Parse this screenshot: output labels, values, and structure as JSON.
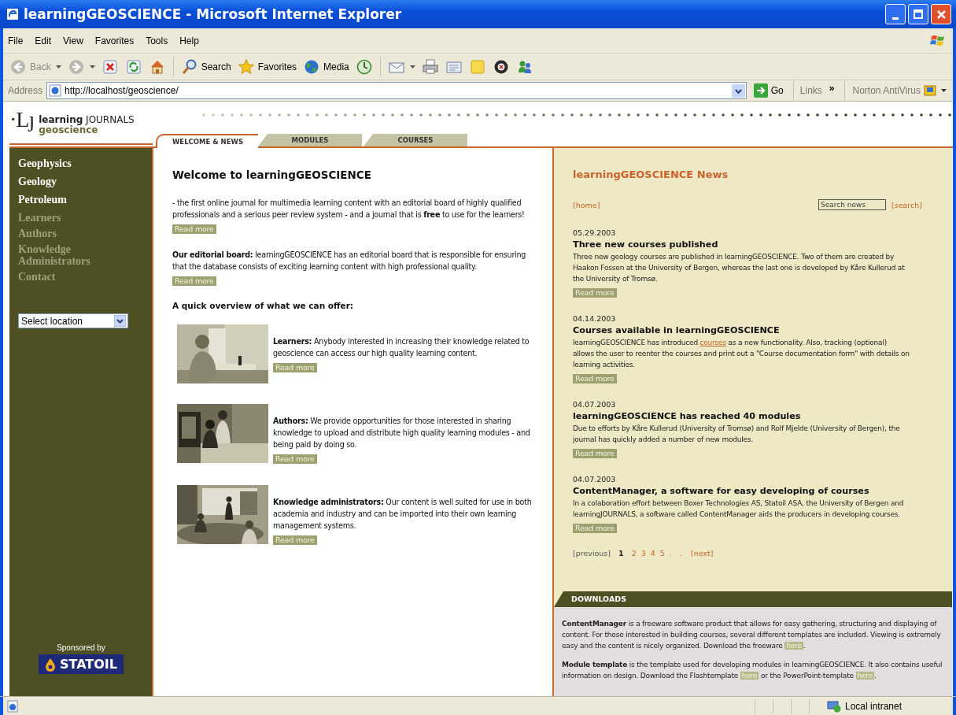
{
  "window": {
    "title": "learningGEOSCIENCE - Microsoft Internet Explorer"
  },
  "menu_bar": [
    "File",
    "Edit",
    "View",
    "Favorites",
    "Tools",
    "Help"
  ],
  "toolbar": [
    {
      "kind": "back",
      "label": "Back",
      "dropdown": true
    },
    {
      "kind": "forward",
      "dropdown": true
    },
    {
      "kind": "stop",
      "dropdown": false
    },
    {
      "kind": "refresh",
      "dropdown": false
    },
    {
      "kind": "home",
      "dropdown": false
    },
    {
      "kind": "separator"
    },
    {
      "kind": "search",
      "label": "Search",
      "dropdown": false
    },
    {
      "kind": "favorites",
      "label": "Favorites",
      "dropdown": false
    },
    {
      "kind": "media",
      "label": "Media",
      "dropdown": false
    },
    {
      "kind": "history",
      "dropdown": false
    },
    {
      "kind": "separator"
    },
    {
      "kind": "mail",
      "dropdown": true
    },
    {
      "kind": "print",
      "dropdown": false
    },
    {
      "kind": "edit",
      "dropdown": false
    },
    {
      "kind": "note",
      "dropdown": false
    },
    {
      "kind": "disc",
      "dropdown": false
    },
    {
      "kind": "people",
      "dropdown": false
    }
  ],
  "address_bar": {
    "label": "Address",
    "url": "http://localhost/geoscience/",
    "go": "Go",
    "links": "Links",
    "links_more": "»",
    "norton": "Norton AntiVirus"
  },
  "site_header": {
    "logo_mark": "·Lȷ",
    "logo_title": "**learning** JOURNALS",
    "logo_subtitle": "geoscience"
  },
  "tabs": [
    {
      "label": "WELCOME & NEWS",
      "selected": true
    },
    {
      "label": "MODULES",
      "selected": false
    },
    {
      "label": "COURSES",
      "selected": false
    }
  ],
  "sidebar": {
    "items": [
      {
        "label": "Geophysics",
        "kind": "primary"
      },
      {
        "label": "Geology",
        "kind": "primary"
      },
      {
        "label": "Petroleum",
        "kind": "primary"
      },
      {
        "label": "Learners",
        "kind": "secondary"
      },
      {
        "label": "Authors",
        "kind": "secondary"
      },
      {
        "label": "Knowledge Administrators",
        "kind": "secondary"
      },
      {
        "label": "Contact",
        "kind": "secondary"
      }
    ],
    "location_select": {
      "value": "Select location"
    },
    "sponsor": {
      "caption": "Sponsored by",
      "name": "STATOIL"
    }
  },
  "welcome": {
    "title": "Welcome to learningGEOSCIENCE",
    "intro": [
      {
        "text": "- the first online journal for multimedia learning content with an editorial board of highly qualified professionals and a serious peer review system - and a journal that is **free** to use for the learners!",
        "link": "Read more"
      },
      {
        "text": "**Our editorial board:** learningGEOSCIENCE has an editorial board that is responsible for ensuring that the database consists of exciting learning content with high professional quality.",
        "link": "Read more"
      }
    ],
    "overview_title": "A quick overview of what we can offer:",
    "offers": [
      {
        "text": "**Learners:** Anybody interested in increasing their knowledge related to geoscience can access our high quality learning content.",
        "link": "Read more"
      },
      {
        "text": "**Authors:** We provide opportunities for those interested in sharing knowledge to upload and distribute high quality learning modules - and being paid by doing so.",
        "link": "Read more"
      },
      {
        "text": "**Knowledge administrators:** Our content is well suited for use in both academia and industry and can be imported into their own learning management systems.",
        "link": "Read more"
      }
    ]
  },
  "news": {
    "title": "learningGEOSCIENCE News",
    "home_link": "[home]",
    "search": {
      "placeholder": "Search news"
    },
    "search_link": "[search]",
    "items": [
      {
        "date": "05.29.2003",
        "title": "Three new courses published",
        "text": [
          {
            "text": "Three new geology courses are published in learningGEOSCIENCE. Two of them are created by Haakon Fossen at the University of Bergen, whereas the last one is developed by Kåre Kullerud at the University of Tromsø."
          }
        ],
        "link": "Read more"
      },
      {
        "date": "04.14.2003",
        "title": "Courses available in learningGEOSCIENCE",
        "text": [
          {
            "text": "learningGEOSCIENCE has introduced "
          },
          {
            "link": "courses"
          },
          {
            "text": " as a new functionality. Also, tracking (optional) allows the user to reenter the courses and print out a \"Course documentation form\" with details on learning activities."
          }
        ],
        "link": "Read more"
      },
      {
        "date": "04.07.2003",
        "title": "learningGEOSCIENCE has reached 40 modules",
        "text": [
          {
            "text": "Due to efforts by Kåre Kullerud (University of Tromsø) and Rolf Mjelde (University of Bergen), the journal has quickly added a number of new modules."
          }
        ],
        "link": "Read more"
      },
      {
        "date": "04.07.2003",
        "title": "ContentManager, a software for easy developing of courses",
        "text": [
          {
            "text": "In a colaboration effort between Boxer Technologies AS, Statoil ASA, the University of Bergen and learningJOURNALS, a software called ContentManager aids the producers in developing courses."
          }
        ],
        "link": "Read more"
      }
    ],
    "pagination": {
      "previous": "[previous]",
      "pages": [
        {
          "label": "1",
          "selected": true
        },
        {
          "label": "2",
          "selected": false
        },
        {
          "label": "3",
          "selected": false
        },
        {
          "label": "4",
          "selected": false
        },
        {
          "label": "5",
          "selected": false
        }
      ],
      "ellipsis": ".   .",
      "next": "[next]"
    }
  },
  "downloads": {
    "title": "DOWNLOADS",
    "paragraphs": [
      [
        {
          "text": "**ContentManager** is a freeware software product that allows for easy gathering, structuring and displaying of content. For those interested in building courses, several different templates are included. Viewing is extremely easy and the content is nicely organized. Download the freeware "
        },
        {
          "link": "here"
        },
        {
          "text": "."
        }
      ],
      [
        {
          "text": "**Module template** is the template used for developing modules in learningGEOSCIENCE. It also contains useful information on design. Download the Flashtemplate "
        },
        {
          "link": "here"
        },
        {
          "text": " or the PowerPoint-template "
        },
        {
          "link": "here"
        },
        {
          "text": "."
        }
      ]
    ]
  },
  "status_bar": {
    "zone": "Local intranet"
  }
}
